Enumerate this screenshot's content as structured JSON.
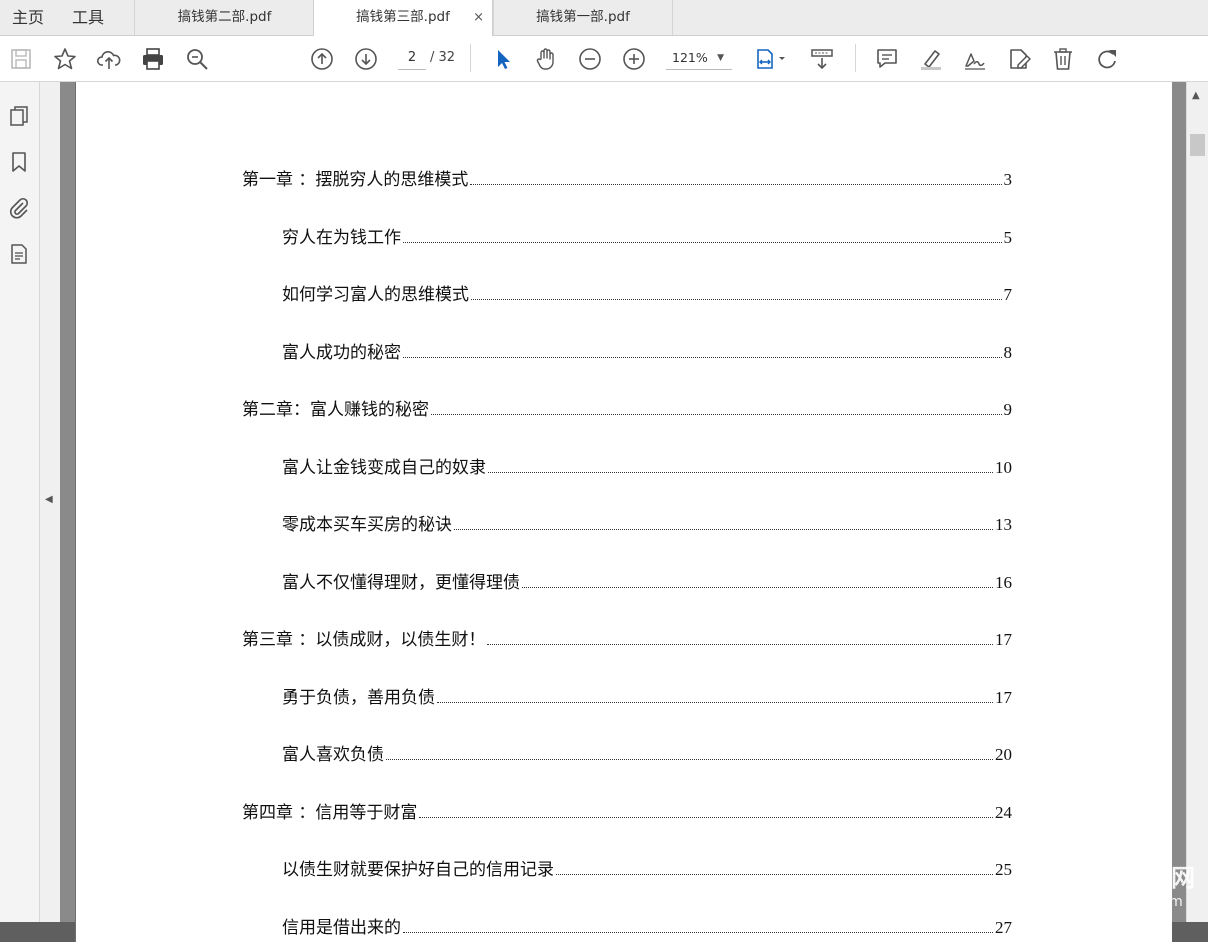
{
  "menu": {
    "home": "主页",
    "tools": "工具"
  },
  "tabs": [
    {
      "label": "搞钱第二部.pdf",
      "active": false
    },
    {
      "label": "搞钱第三部.pdf",
      "active": true,
      "close": "×"
    },
    {
      "label": "搞钱第一部.pdf",
      "active": false
    }
  ],
  "toolbar": {
    "current_page": "2",
    "total_pages": "/ 32",
    "zoom": "121%",
    "accent_color": "#1565c0"
  },
  "toc": [
    {
      "title": "第一章 ：摆脱穷人的思维模式",
      "page": "3",
      "level": 1
    },
    {
      "title": "穷人在为钱工作",
      "page": "5",
      "level": 2
    },
    {
      "title": "如何学习富人的思维模式",
      "page": "7",
      "level": 2
    },
    {
      "title": "富人成功的秘密",
      "page": "8",
      "level": 2
    },
    {
      "title": "第二章：富人赚钱的秘密",
      "page": "9",
      "level": 1
    },
    {
      "title": "富人让金钱变成自己的奴隶",
      "page": "10",
      "level": 2
    },
    {
      "title": "零成本买车买房的秘诀",
      "page": "13",
      "level": 2
    },
    {
      "title": "富人不仅懂得理财，更懂得理债",
      "page": "16",
      "level": 2
    },
    {
      "title": "第三章 ：以债成财，以债生财！",
      "page": "17",
      "level": 1
    },
    {
      "title": "勇于负债，善用负债",
      "page": "17",
      "level": 2
    },
    {
      "title": "富人喜欢负债",
      "page": "20",
      "level": 2
    },
    {
      "title": "第四章 ：信用等于财富",
      "page": "24",
      "level": 1
    },
    {
      "title": "以债生财就要保护好自己的信用记录",
      "page": "25",
      "level": 2
    },
    {
      "title": "信用是借出来的",
      "page": "27",
      "level": 2
    }
  ],
  "watermark": {
    "main": "我帮找网",
    "sub": "wobangzhao.com"
  }
}
